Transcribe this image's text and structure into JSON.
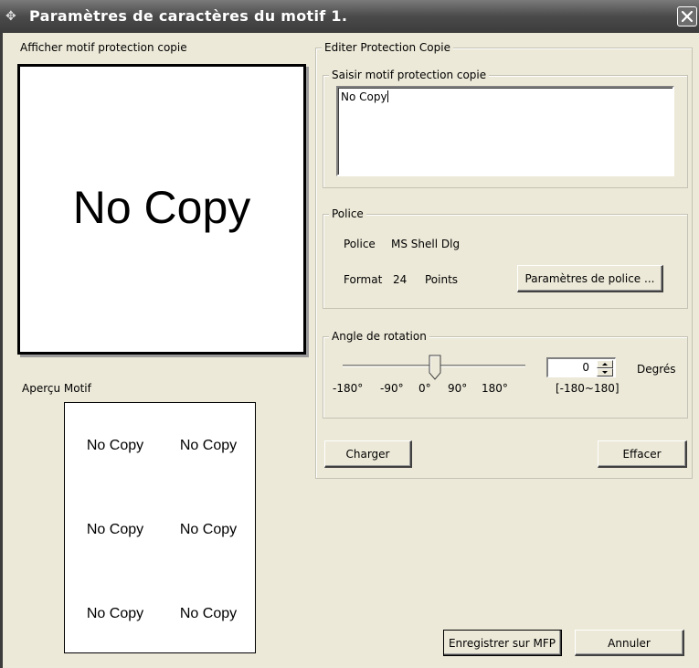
{
  "window": {
    "title": "Paramètres de caractères du motif 1.",
    "app_icon": "pin-icon",
    "close_icon": "close-icon"
  },
  "preview": {
    "label": "Afficher motif protection copie",
    "text": "No Copy"
  },
  "pattern_preview": {
    "label": "Aperçu Motif",
    "items": [
      "No Copy",
      "No Copy",
      "No Copy",
      "No Copy",
      "No Copy",
      "No Copy"
    ]
  },
  "edit": {
    "legend": "Editer Protection Copie",
    "input_group_legend": "Saisir motif protection copie",
    "input_value": "No Copy"
  },
  "font": {
    "legend": "Police",
    "font_label": "Police",
    "font_value": "MS Shell Dlg",
    "size_label": "Format",
    "size_value": "24",
    "size_unit": "Points",
    "settings_button": "Paramètres de police ..."
  },
  "rotation": {
    "legend": "Angle de rotation",
    "ticks": [
      "-180°",
      "-90°",
      "0°",
      "90°",
      "180°"
    ],
    "value": "0",
    "unit": "Degrés",
    "range": "[-180~180]"
  },
  "actions": {
    "load": "Charger",
    "clear": "Effacer",
    "save": "Enregistrer sur MFP",
    "cancel": "Annuler"
  },
  "colors": {
    "window_bg": "#ece9d8",
    "titlebar": "#4a4a4a"
  }
}
